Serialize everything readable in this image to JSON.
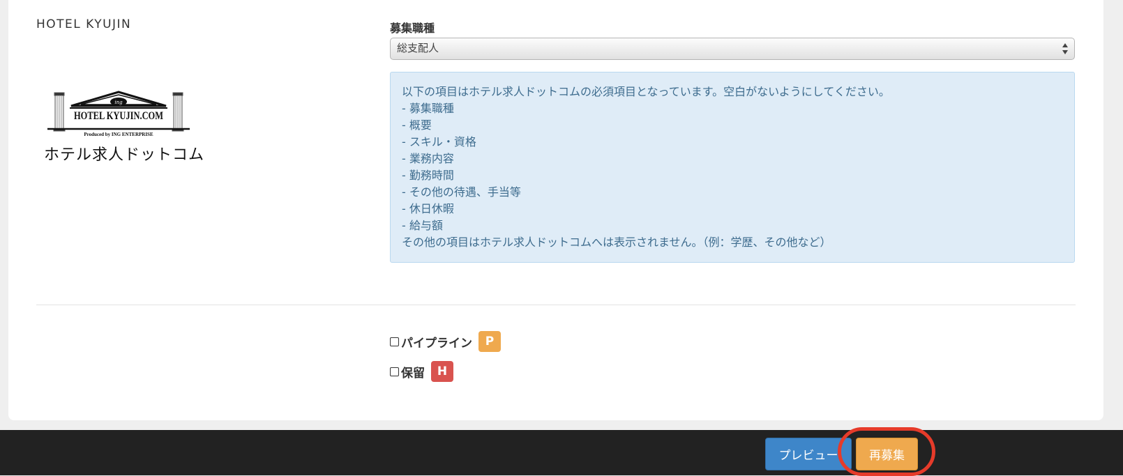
{
  "brand": {
    "section_title": "HOTEL KYUJIN",
    "logo_text": "HOTEL KYUJIN.COM",
    "logo_sub": "Produced by ING ENTERPRISE",
    "logo_mark": "ing",
    "logo_jp": "ホテル求人ドットコム"
  },
  "form": {
    "job_type_label": "募集職種",
    "job_type_value": "総支配人"
  },
  "info": {
    "intro": "以下の項目はホテル求人ドットコムの必須項目となっています。空白がないようにしてください。",
    "items": [
      "- 募集職種",
      "- 概要",
      "- スキル・資格",
      "- 業務内容",
      "- 勤務時間",
      "- その他の待遇、手当等",
      "- 休日休暇",
      "- 給与額"
    ],
    "note": "その他の項目はホテル求人ドットコムへは表示されません。（例：学歴、その他など）"
  },
  "checks": {
    "pipeline_label": "パイプライン",
    "pipeline_badge": "P",
    "pipeline_color": "#efa94e",
    "hold_label": "保留",
    "hold_badge": "H",
    "hold_color": "#d9534f"
  },
  "footer": {
    "preview_label": "プレビュー",
    "recruit_label": "再募集"
  },
  "colors": {
    "primary": "#3e86c9",
    "warning": "#efa94e",
    "highlight": "#e63b2a"
  }
}
